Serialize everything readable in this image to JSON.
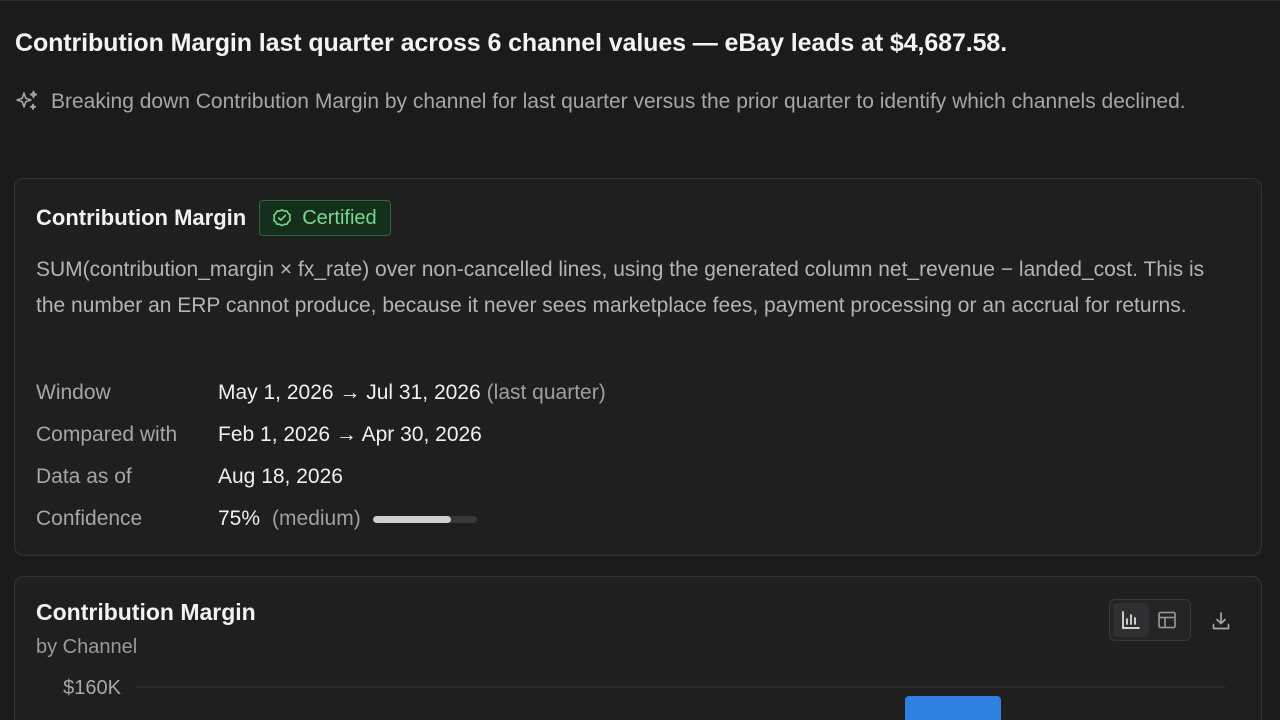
{
  "headline": "Contribution Margin last quarter across 6 channel values — eBay leads at $4,687.58.",
  "reasoning": {
    "icon": "sparkles-icon",
    "text": "Breaking down Contribution Margin by channel for last quarter versus the prior quarter to identify which channels declined."
  },
  "metric": {
    "name": "Contribution Margin",
    "badge": "Certified",
    "badge_icon": "check-circle-icon",
    "definition": "SUM(contribution_margin × fx_rate) over non-cancelled lines, using the generated column net_revenue − landed_cost. This is the number an ERP cannot produce, because it never sees marketplace fees, payment processing or an accrual for returns.",
    "window_label": "Window",
    "window_value": "May 1, 2026 → Jul 31, 2026",
    "window_note": "(last quarter)",
    "compared_label": "Compared with",
    "compared_value": "Feb 1, 2026 → Apr 30, 2026",
    "asof_label": "Data as of",
    "asof_value": "Aug 18, 2026",
    "confidence_label": "Confidence",
    "confidence_value": "75%",
    "confidence_note": "(medium)",
    "confidence_fraction": 0.75
  },
  "chart_card": {
    "title": "Contribution Margin",
    "subtitle": "by Channel",
    "toggle": {
      "chart_icon": "bar-chart-icon",
      "table_icon": "table-icon",
      "active": "chart"
    },
    "download_icon": "download-icon"
  },
  "chart_data": {
    "type": "bar",
    "title": "Contribution Margin",
    "subtitle": "by Channel",
    "y_ticks_visible": [
      "$160K"
    ],
    "y_tick_values": [
      160000
    ],
    "ylim": [
      0,
      160000
    ],
    "grid": true,
    "bar_color": "#2f7fe0"
  },
  "colors": {
    "background": "#1b1b1c",
    "card": "#1f1f20",
    "certified_green": "#79d68e",
    "bar_blue": "#2f7fe0"
  }
}
